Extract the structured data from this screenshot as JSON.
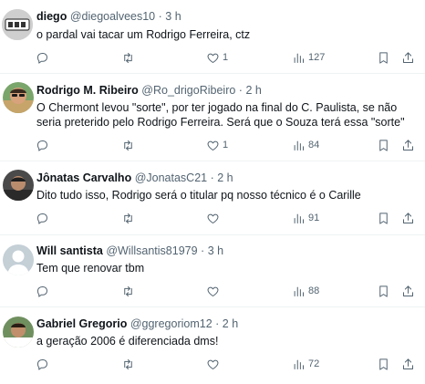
{
  "tweets": [
    {
      "name": "diego",
      "handle": "@diegoalvees10",
      "time": "3 h",
      "text": "o pardal vai tacar um Rodrigo Ferreira, ctz",
      "likes": "1",
      "views": "127",
      "avatar_icon": "cartoon-avatar-icon"
    },
    {
      "name": "Rodrigo M. Ribeiro",
      "handle": "@Ro_drigoRibeiro",
      "time": "2 h",
      "text": "O Chermont levou \"sorte\", por ter jogado na final do C. Paulista, se não seria preterido pelo Rodrigo Ferreira. Será que o Souza terá essa \"sorte\"",
      "likes": "1",
      "views": "84",
      "avatar_icon": "man-sunglasses-avatar-icon"
    },
    {
      "name": "Jônatas Carvalho",
      "handle": "@JonatasC21",
      "time": "2 h",
      "text": "Dito tudo isso, Rodrigo será o titular pq nosso técnico é o Carille",
      "likes": "",
      "views": "91",
      "avatar_icon": "man-photo-avatar-icon"
    },
    {
      "name": "Will santista",
      "handle": "@Willsantis81979",
      "time": "3 h",
      "text": "Tem que renovar tbm",
      "likes": "",
      "views": "88",
      "avatar_icon": "default-person-avatar-icon"
    },
    {
      "name": "Gabriel Gregorio",
      "handle": "@ggregoriom12",
      "time": "2 h",
      "text": "a geração 2006 é diferenciada dms!",
      "likes": "",
      "views": "72",
      "avatar_icon": "young-man-avatar-icon"
    }
  ],
  "meta_separator": "·",
  "colors": {
    "text": "#0f1419",
    "secondary": "#536471",
    "divider": "#eff3f4"
  }
}
